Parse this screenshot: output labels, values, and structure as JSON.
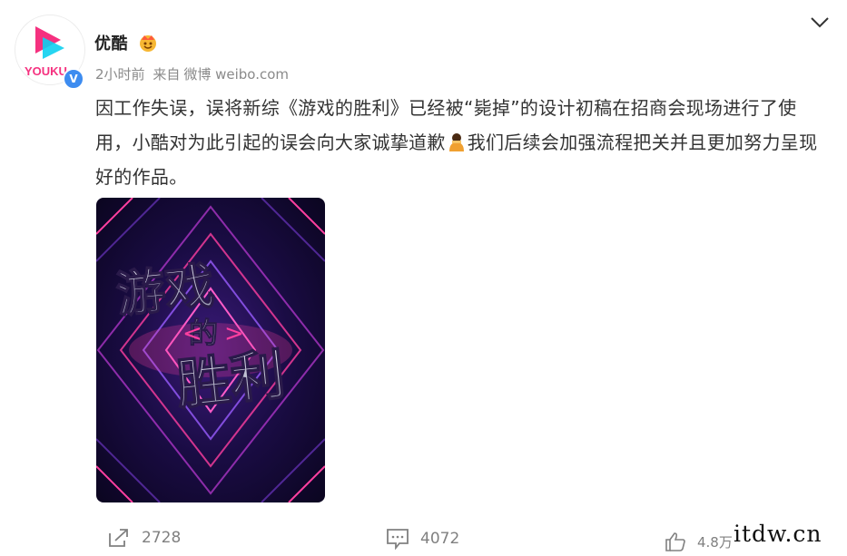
{
  "post": {
    "author": "优酷",
    "avatar_label": "YOUKU",
    "time": "2小时前",
    "source_prefix": "来自",
    "source": "微博 weibo.com",
    "text_part1": "因工作失误，误将新综《游戏的胜利》已经被“毙掉”的设计初稿在招商会现场进行了使用，小酷对为此引起的误会向大家诚挚道歉",
    "text_part2": "我们后续会加强流程把关并且更加努力呈现好的作品。",
    "emoji": "bow-emoji"
  },
  "poster": {
    "line1": "游戏",
    "line2": "的",
    "line3": "胜利"
  },
  "actions": {
    "repost_count": "2728",
    "comment_count": "4072",
    "like_count": "4.8万"
  },
  "watermark": "itdw.cn",
  "colors": {
    "brand_pink": "#f5317f",
    "brand_cyan": "#0ed0f0",
    "verified_blue": "#3d8cf0"
  }
}
